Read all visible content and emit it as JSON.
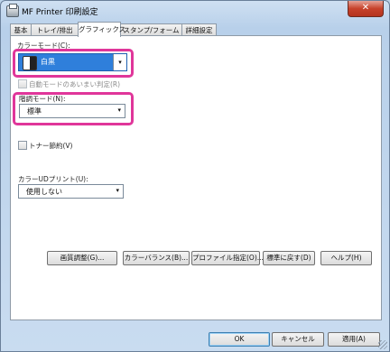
{
  "window": {
    "title": "MF Printer 印刷設定",
    "close_label": "✕"
  },
  "tabs": [
    {
      "label": "基本"
    },
    {
      "label": "トレイ/排出"
    },
    {
      "label": "グラフィックス"
    },
    {
      "label": "スタンプ/フォーム"
    },
    {
      "label": "詳細設定"
    }
  ],
  "color_mode": {
    "label": "カラーモード(C):",
    "value": "白黒"
  },
  "auto_mode_check": {
    "label": "自動モードのあいまい判定(R)"
  },
  "gradation": {
    "label": "階調モード(N):",
    "value": "標準"
  },
  "toner_save": {
    "label": "トナー節約(V)"
  },
  "color_ud": {
    "label": "カラーUDプリント(U):",
    "value": "使用しない"
  },
  "action_buttons": [
    {
      "label": "画質調整(G)..."
    },
    {
      "label": "カラーバランス(B)..."
    },
    {
      "label": "プロファイル指定(O)..."
    },
    {
      "label": "標準に戻す(D)"
    },
    {
      "label": "ヘルプ(H)"
    }
  ],
  "footer_buttons": {
    "ok": "OK",
    "cancel": "キャンセル",
    "apply": "適用(A)"
  },
  "icons": {
    "dropdown": "▾"
  },
  "colors": {
    "highlight": "#e0369a",
    "selected": "#2f7fdb"
  }
}
